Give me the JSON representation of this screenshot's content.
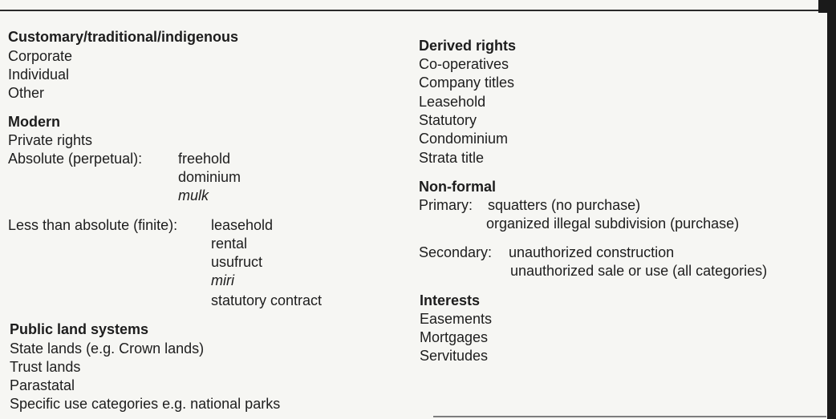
{
  "left": {
    "customary": {
      "heading": "Customary/traditional/indigenous",
      "items": [
        "Corporate",
        "Individual",
        "Other"
      ]
    },
    "modern": {
      "heading": "Modern",
      "private_rights": "Private rights",
      "absolute_label": "Absolute (perpetual):",
      "absolute_items": [
        "freehold",
        "dominium",
        "mulk"
      ],
      "less_label": "Less than absolute (finite):",
      "less_items": [
        "leasehold",
        "rental",
        "usufruct",
        "miri",
        "statutory contract"
      ]
    },
    "public": {
      "heading": "Public land systems",
      "items": [
        "State lands (e.g. Crown lands)",
        "Trust lands",
        "Parastatal",
        "Specific use categories e.g. national parks"
      ]
    }
  },
  "right": {
    "derived": {
      "heading": "Derived rights",
      "items": [
        "Co-operatives",
        "Company titles",
        "Leasehold",
        "Statutory",
        "Condominium",
        "Strata title"
      ]
    },
    "nonformal": {
      "heading": "Non-formal",
      "primary_label": "Primary:",
      "primary_items": [
        "squatters (no purchase)",
        "organized illegal subdivision (purchase)"
      ],
      "secondary_label": "Secondary:",
      "secondary_items": [
        "unauthorized construction",
        "unauthorized sale or use (all categories)"
      ]
    },
    "interests": {
      "heading": "Interests",
      "items": [
        "Easements",
        "Mortgages",
        "Servitudes"
      ]
    }
  }
}
